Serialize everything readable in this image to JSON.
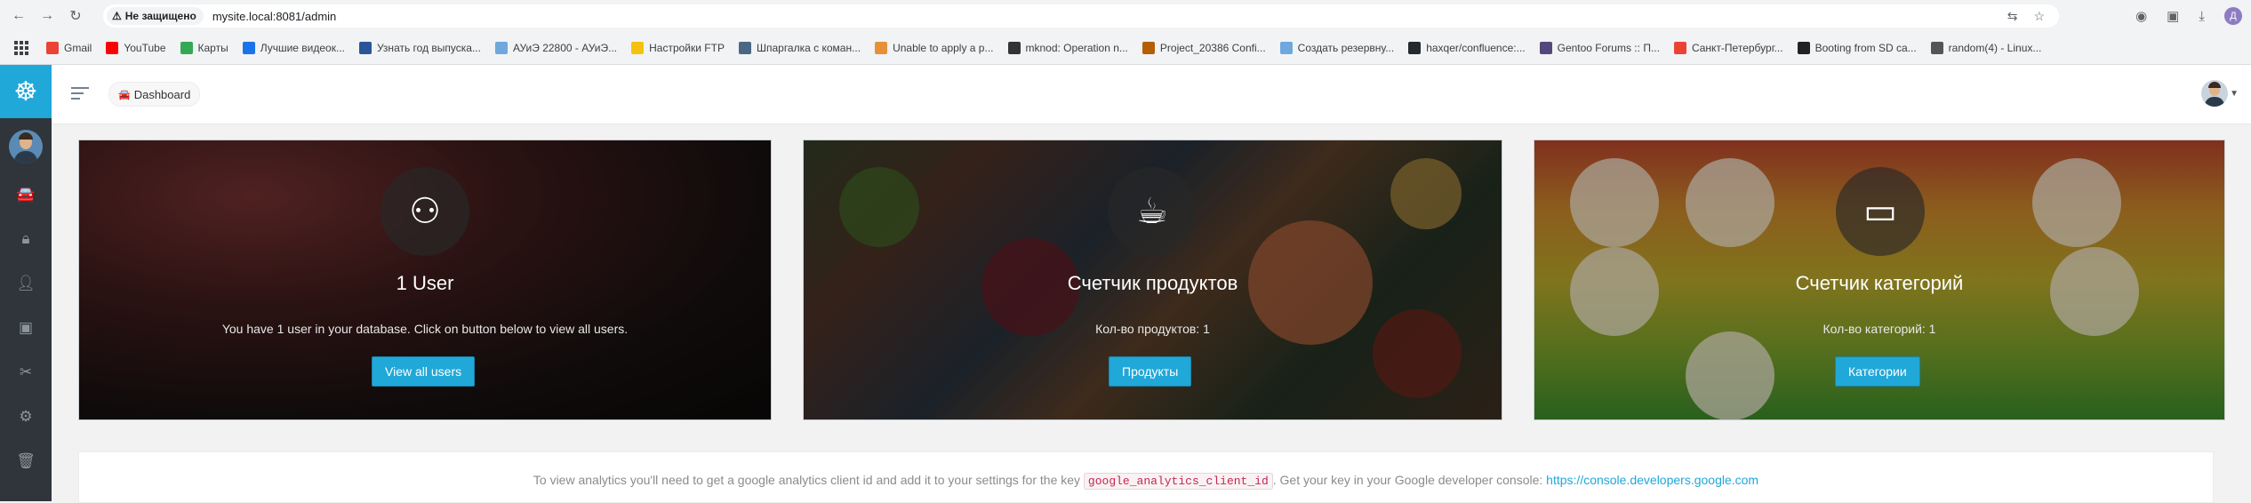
{
  "browser": {
    "security_label": "Не защищено",
    "url": "mysite.local:8081/admin",
    "profile_initial": "Д"
  },
  "bookmarks": [
    {
      "label": "Gmail",
      "color": "#ea4335"
    },
    {
      "label": "YouTube",
      "color": "#ff0000"
    },
    {
      "label": "Карты",
      "color": "#34a853"
    },
    {
      "label": "Лучшие видеок...",
      "color": "#1a73e8"
    },
    {
      "label": "Узнать год выпуска...",
      "color": "#2a5699"
    },
    {
      "label": "АУиЭ 22800 - АУиЭ...",
      "color": "#6fa8dc"
    },
    {
      "label": "Настройки FTP",
      "color": "#f4c20d"
    },
    {
      "label": "Шпаргалка с коман...",
      "color": "#4a6785"
    },
    {
      "label": "Unable to apply a p...",
      "color": "#e69138"
    },
    {
      "label": "mknod: Operation n...",
      "color": "#333333"
    },
    {
      "label": "Project_20386 Confi...",
      "color": "#b45f06"
    },
    {
      "label": "Создать резервну...",
      "color": "#6fa8dc"
    },
    {
      "label": "haxqer/confluence:...",
      "color": "#24292e"
    },
    {
      "label": "Gentoo Forums :: П...",
      "color": "#54487a"
    },
    {
      "label": "Санкт-Петербург...",
      "color": "#ea4335"
    },
    {
      "label": "Booting from SD ca...",
      "color": "#222222"
    },
    {
      "label": "random(4) - Linux...",
      "color": "#555555"
    }
  ],
  "header": {
    "breadcrumb": "Dashboard"
  },
  "cards": {
    "users": {
      "title": "1 User",
      "description": "You have 1 user in your database. Click on button below to view all users.",
      "button": "View all users"
    },
    "products": {
      "title": "Счетчик продуктов",
      "description": "Кол-во продуктов: 1",
      "button": "Продукты"
    },
    "categories": {
      "title": "Счетчик категорий",
      "description": "Кол-во категорий: 1",
      "button": "Категории"
    }
  },
  "analytics": {
    "text_before": "To view analytics you'll need to get a google analytics client id and add it to your settings for the key",
    "key": "google_analytics_client_id",
    "text_after": ". Get your key in your Google developer console:",
    "link": "https://console.developers.google.com"
  },
  "colors": {
    "accent": "#20a8d8",
    "sidebar": "#2f353b"
  }
}
